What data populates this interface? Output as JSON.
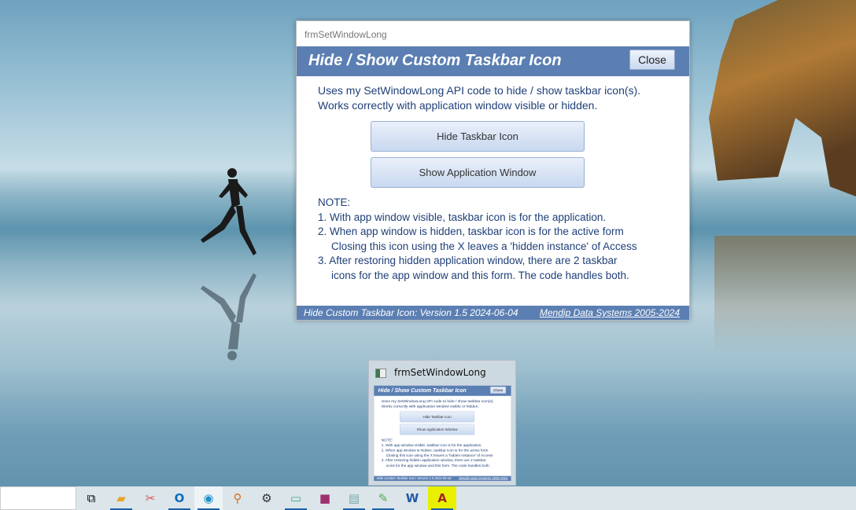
{
  "form": {
    "window_title": "frmSetWindowLong",
    "header_title": "Hide / Show Custom Taskbar Icon",
    "close_label": "Close",
    "intro": [
      "Uses my SetWindowLong API code to hide / show taskbar icon(s).",
      "Works correctly with application window visible or hidden."
    ],
    "hide_button": "Hide Taskbar Icon",
    "show_button": "Show Application Window",
    "note_title": "NOTE:",
    "notes": [
      "1.  With app window visible, taskbar icon is for the application.",
      "2.  When app window is hidden, taskbar icon is for the active form",
      "Closing this icon using the X leaves a 'hidden instance' of Access",
      "3.  After restoring hidden application window, there are 2 taskbar",
      "icons for the app window and this form. The code handles both."
    ],
    "footer_left": "Hide Custom Taskbar Icon:  Version 1.5  2024-06-04",
    "footer_right": "Mendip Data Systems 2005-2024",
    "accent": "#5b7fb3"
  },
  "thumbnail": {
    "title": "frmSetWindowLong"
  },
  "taskbar": {
    "items": [
      "task-view",
      "file-explorer",
      "snipping-tool",
      "outlook",
      "edge",
      "search-tool",
      "settings",
      "resource-monitor",
      "media-app",
      "notepad",
      "notepad-edit",
      "word",
      "access"
    ]
  }
}
